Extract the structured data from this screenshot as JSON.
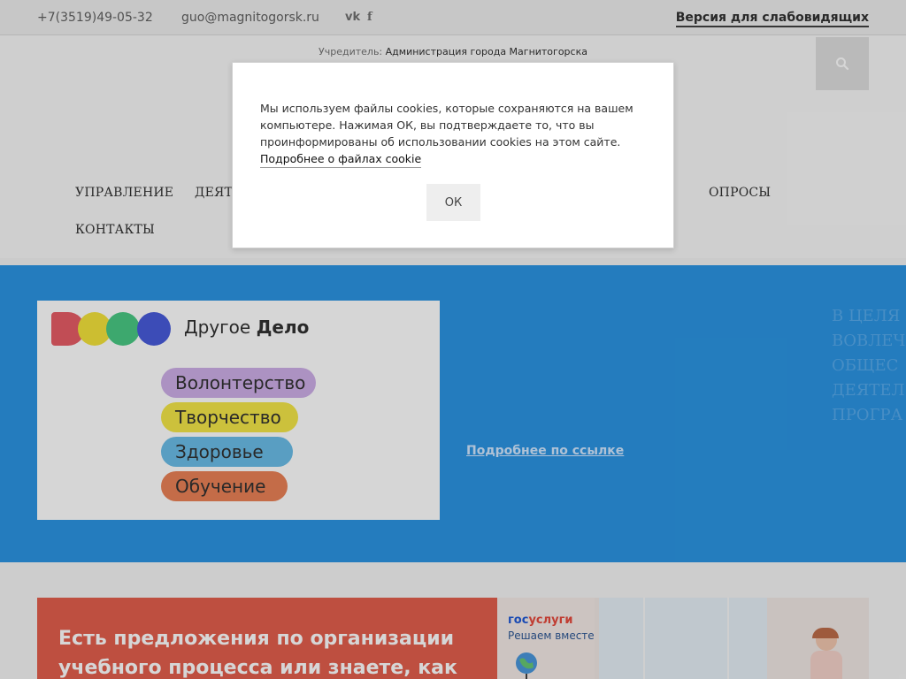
{
  "topbar": {
    "phone": "+7(3519)49-05-32",
    "email": "guo@magnitogorsk.ru",
    "social_icons": [
      "vk-icon",
      "facebook-icon"
    ],
    "vk_glyph": "vk",
    "fb_glyph": "f",
    "accessibility_link": "Версия для слабовидящих"
  },
  "header": {
    "founder_label": "Учредитель:",
    "founder_org": "Администрация города Магнитогорска",
    "search_icon": "search-icon",
    "nav": [
      "УПРАВЛЕНИЕ",
      "ДЕЯТЕЛЬНОСТЬ",
      "ОПРОСЫ",
      "КОНТАКТЫ"
    ]
  },
  "banner": {
    "brand_part1": "Другое",
    "brand_part2": "Дело",
    "pills": [
      "Волонтерство",
      "Творчество",
      "Здоровье",
      "Обучение"
    ],
    "more_link": "Подробнее по ссылке",
    "side_text": "В ЦЕЛЯ\nВОВЛЕЧ\nОБЩЕС\nДЕЯТЕЛ\nПРОГРА",
    "colors": {
      "background": "#1b8ce0",
      "dot_red": "#e4505a",
      "dot_yellow": "#f2e02c",
      "dot_green": "#3cc47a",
      "dot_blue": "#3a4fd8",
      "pill_volunteer": "#c9a8e6",
      "pill_creative": "#f2e53a",
      "pill_health": "#5fb8e6",
      "pill_study": "#e8784a"
    }
  },
  "bottom": {
    "red_card_text": "Есть предложения по организации\nучебного процесса или знаете, как",
    "gosuslugi_part1": "гос",
    "gosuslugi_part2": "услуги",
    "gosuslugi_sub": "Решаем вместе"
  },
  "cookie_modal": {
    "text": "Мы используем файлы cookies, которые сохраняются на вашем компьютере. Нажимая ОК, вы подтверждаете то, что вы проинформированы об использовании cookies на этом сайте.",
    "link": "Подробнее о файлах cookie",
    "ok_label": "ОК"
  }
}
